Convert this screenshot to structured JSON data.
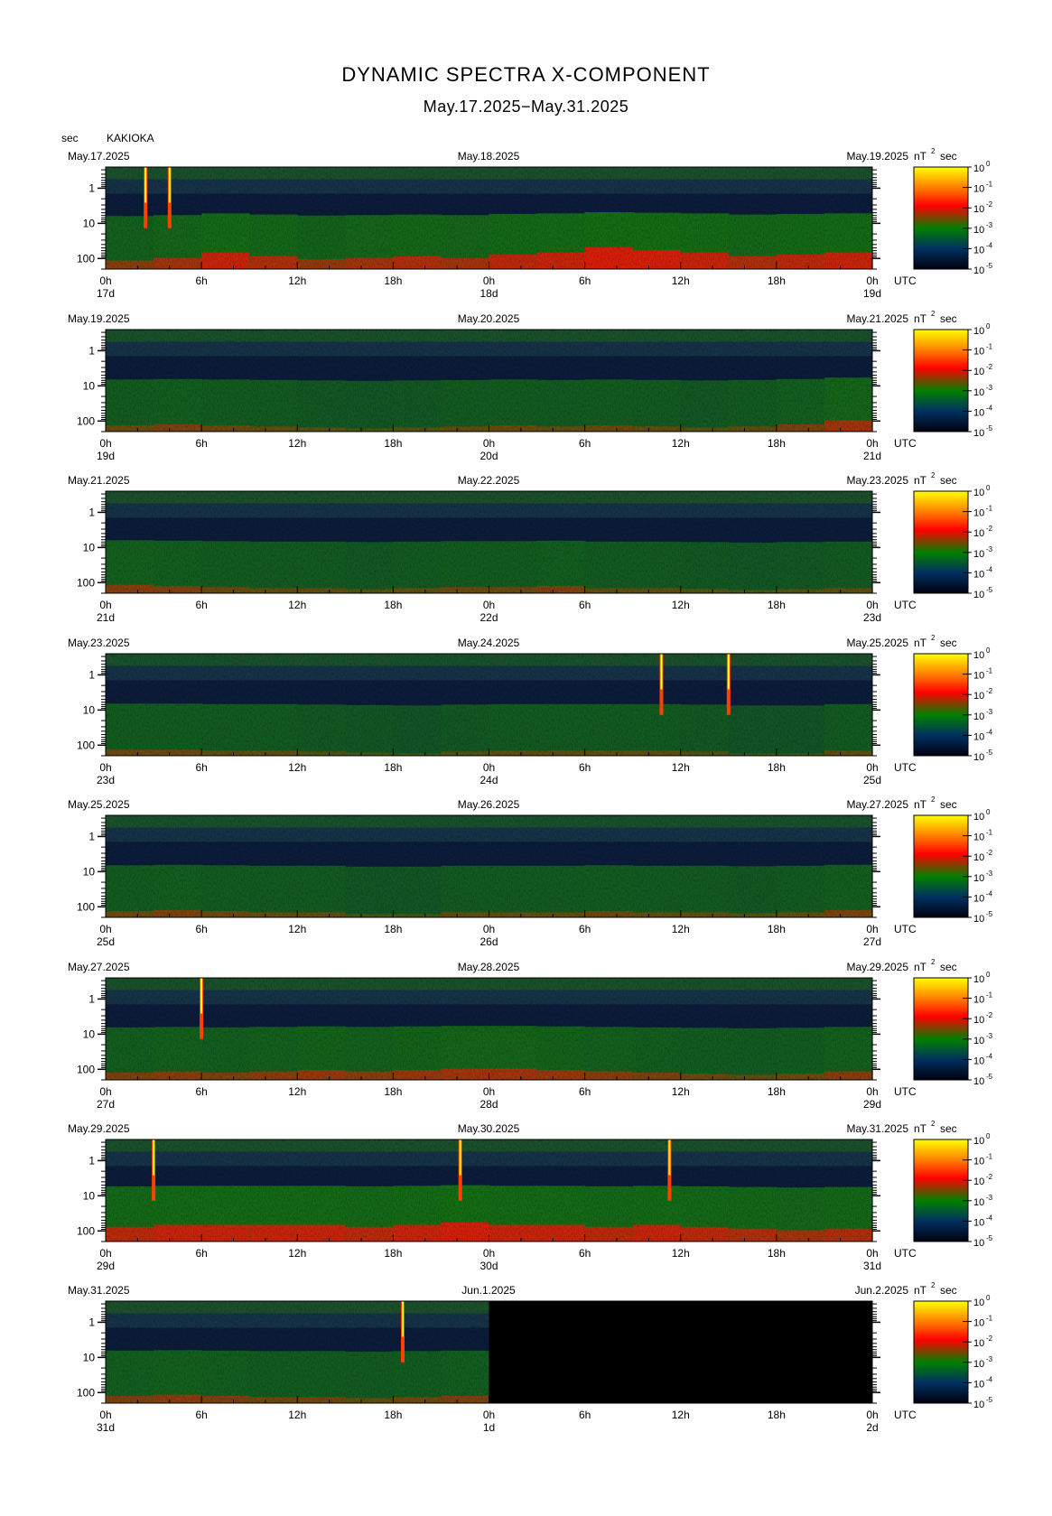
{
  "header": {
    "title": "DYNAMIC SPECTRA X-COMPONENT",
    "subtitle": "May.17.2025−May.31.2025",
    "y_unit": "sec",
    "station": "KAKIOKA",
    "color_unit": "nT",
    "color_unit_exp": "2",
    "color_unit_suffix": "sec",
    "timezone": "UTC"
  },
  "chart_data": {
    "type": "heatmap",
    "x_ticks": [
      "0h",
      "6h",
      "12h",
      "18h",
      "0h",
      "6h",
      "12h",
      "18h",
      "0h"
    ],
    "y_ticks": [
      "1",
      "10",
      "100"
    ],
    "y_scale": "log",
    "y_direction": "period increasing downward",
    "colorbar": {
      "scale": "log",
      "ticks_exp": [
        "0",
        "-1",
        "-2",
        "-3",
        "-4",
        "-5"
      ],
      "tick_base": "10",
      "colors": [
        "#ffff00",
        "#ff8000",
        "#ff0000",
        "#008000",
        "#003060",
        "#000010"
      ]
    },
    "panels": [
      {
        "date_left": "May.17.2025",
        "date_mid": "May.18.2025",
        "date_right": "May.19.2025",
        "day_labels": [
          "17d",
          "18d",
          "19d"
        ],
        "activity": [
          0.45,
          0.55,
          0.7,
          0.6,
          0.5,
          0.55,
          0.6,
          0.55,
          0.65,
          0.7,
          0.8,
          0.75,
          0.7,
          0.6,
          0.65,
          0.7
        ],
        "spikes": [
          2.5,
          4.0
        ],
        "data_end_hours": 48
      },
      {
        "date_left": "May.19.2025",
        "date_mid": "May.20.2025",
        "date_right": "May.21.2025",
        "day_labels": [
          "19d",
          "20d",
          "21d"
        ],
        "activity": [
          0.35,
          0.4,
          0.35,
          0.3,
          0.25,
          0.2,
          0.25,
          0.3,
          0.35,
          0.3,
          0.35,
          0.3,
          0.25,
          0.3,
          0.4,
          0.55
        ],
        "spikes": [],
        "data_end_hours": 48
      },
      {
        "date_left": "May.21.2025",
        "date_mid": "May.22.2025",
        "date_right": "May.23.2025",
        "day_labels": [
          "21d",
          "22d",
          "23d"
        ],
        "activity": [
          0.45,
          0.4,
          0.35,
          0.3,
          0.3,
          0.25,
          0.3,
          0.35,
          0.35,
          0.4,
          0.3,
          0.3,
          0.25,
          0.2,
          0.25,
          0.3
        ],
        "spikes": [],
        "data_end_hours": 48
      },
      {
        "date_left": "May.23.2025",
        "date_mid": "May.24.2025",
        "date_right": "May.25.2025",
        "day_labels": [
          "23d",
          "24d",
          "25d"
        ],
        "activity": [
          0.35,
          0.35,
          0.3,
          0.3,
          0.25,
          0.2,
          0.15,
          0.25,
          0.3,
          0.3,
          0.3,
          0.3,
          0.25,
          0.15,
          0.15,
          0.3
        ],
        "spikes": [
          34.8,
          39.0
        ],
        "data_end_hours": 48
      },
      {
        "date_left": "May.25.2025",
        "date_mid": "May.26.2025",
        "date_right": "May.27.2025",
        "day_labels": [
          "25d",
          "26d",
          "27d"
        ],
        "activity": [
          0.35,
          0.4,
          0.35,
          0.3,
          0.3,
          0.2,
          0.2,
          0.3,
          0.3,
          0.3,
          0.35,
          0.3,
          0.3,
          0.25,
          0.3,
          0.4
        ],
        "spikes": [],
        "data_end_hours": 48
      },
      {
        "date_left": "May.27.2025",
        "date_mid": "May.28.2025",
        "date_right": "May.29.2025",
        "day_labels": [
          "27d",
          "28d",
          "29d"
        ],
        "activity": [
          0.4,
          0.45,
          0.4,
          0.45,
          0.5,
          0.45,
          0.5,
          0.55,
          0.55,
          0.5,
          0.45,
          0.4,
          0.35,
          0.3,
          0.35,
          0.45
        ],
        "spikes": [
          6.0
        ],
        "data_end_hours": 48
      },
      {
        "date_left": "May.29.2025",
        "date_mid": "May.30.2025",
        "date_right": "May.31.2025",
        "day_labels": [
          "29d",
          "30d",
          "31d"
        ],
        "activity": [
          0.65,
          0.7,
          0.7,
          0.7,
          0.7,
          0.65,
          0.7,
          0.75,
          0.7,
          0.7,
          0.65,
          0.7,
          0.65,
          0.6,
          0.55,
          0.6
        ],
        "spikes": [
          3.0,
          22.2,
          35.3
        ],
        "data_end_hours": 48
      },
      {
        "date_left": "May.31.2025",
        "date_mid": "Jun.1.2025",
        "date_right": "Jun.2.2025",
        "day_labels": [
          "31d",
          "1d",
          "2d"
        ],
        "activity": [
          0.4,
          0.45,
          0.4,
          0.35,
          0.35,
          0.3,
          0.35,
          0.4,
          0.45,
          0,
          0,
          0,
          0,
          0,
          0,
          0
        ],
        "spikes": [
          18.6
        ],
        "data_end_hours": 24
      }
    ]
  }
}
